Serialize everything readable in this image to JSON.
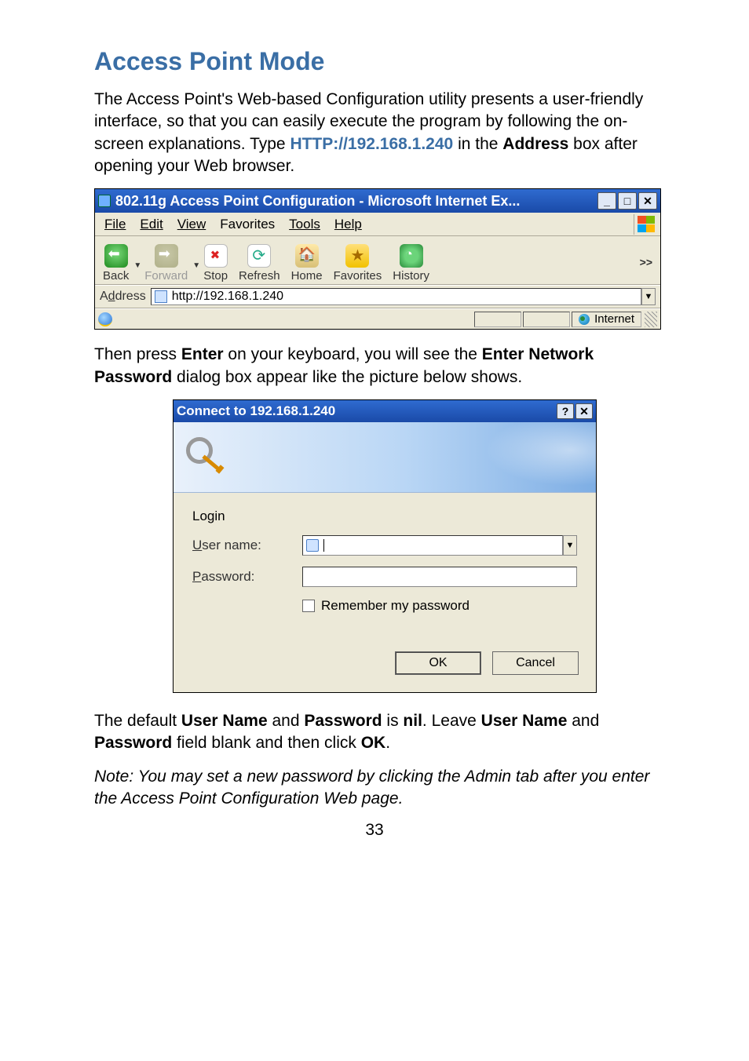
{
  "page_title": "Access Point Mode",
  "intro_1a": "The Access Point's Web-based Configuration utility presents a user-friendly interface, so that you can easily execute the program by following the on-screen explanations. Type ",
  "intro_http": "HTTP://192.168.1.240",
  "intro_1b": " in the ",
  "intro_Address_word": "Address",
  "intro_1c": " box after opening your Web browser.",
  "ie": {
    "title": "802.11g Access Point Configuration - Microsoft Internet Ex...",
    "menus": {
      "file": "File",
      "edit": "Edit",
      "view": "View",
      "favorites": "Favorites",
      "tools": "Tools",
      "help": "Help"
    },
    "toolbar": {
      "back": "Back",
      "forward": "Forward",
      "stop": "Stop",
      "refresh": "Refresh",
      "home": "Home",
      "favorites": "Favorites",
      "history": "History",
      "more": ">>"
    },
    "address_label_prefix": "A",
    "address_label_u": "d",
    "address_label_suffix": "dress",
    "address_url": "http://192.168.1.240",
    "status_zone": "Internet"
  },
  "paragraph_enter": {
    "p1": "Then press ",
    "enter": "Enter",
    "p2": " on your keyboard, you will see the ",
    "np": "Enter Network Password",
    "p3": " dialog box appear like the picture below shows."
  },
  "dlg": {
    "title": "Connect to 192.168.1.240",
    "login_label": "Login",
    "username_u": "U",
    "username_rest": "ser name:",
    "password_u": "P",
    "password_rest": "assword:",
    "remember_u": "R",
    "remember_rest": "emember my password",
    "ok": "OK",
    "cancel": "Cancel"
  },
  "paragraph_default": {
    "p1": "The default ",
    "un": "User Name",
    "p2": " and ",
    "pw": "Password",
    "p3": " is ",
    "nil": "nil",
    "p4": ". Leave ",
    "un2": "User Name",
    "p5": " and ",
    "pw2": "Password",
    "p6": " field blank and then click ",
    "ok": "OK",
    "p7": "."
  },
  "note": "Note: You may set a new password by clicking the Admin tab after you enter the Access Point Configuration Web page.",
  "page_number": "33",
  "win_btns": {
    "min": "_",
    "max": "□",
    "close": "✕",
    "help": "?"
  }
}
